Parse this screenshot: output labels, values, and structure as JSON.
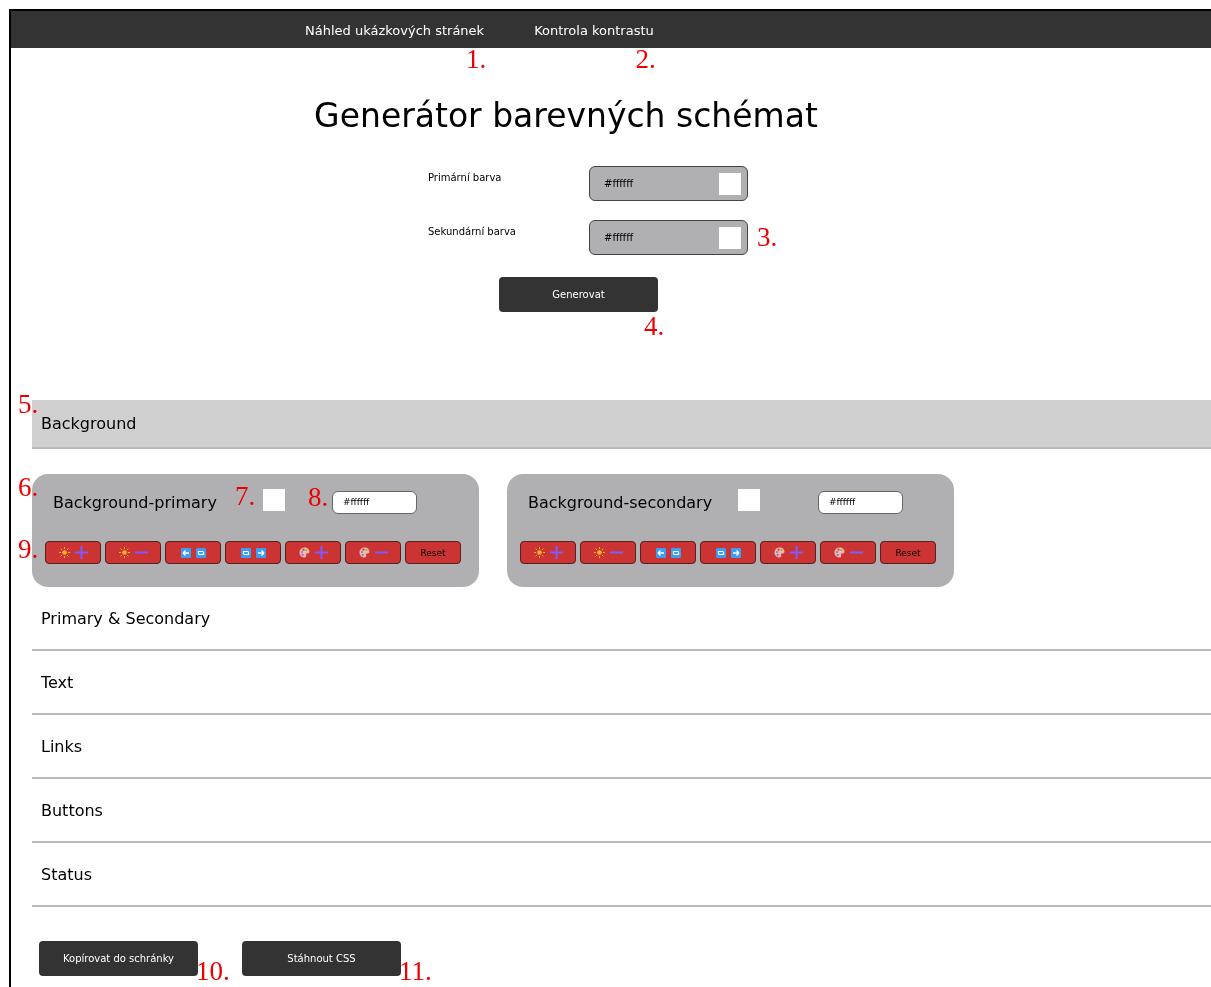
{
  "nav": [
    {
      "label": "Náhled ukázkových stránek",
      "note": "1."
    },
    {
      "label": "Kontrola kontrastu",
      "note": "2."
    }
  ],
  "title": "Generátor barevných schémat",
  "color_inputs": [
    {
      "label": "Primární barva",
      "value": "#ffffff",
      "color": "#ffffff"
    },
    {
      "label": "Sekundární barva",
      "value": "#ffffff",
      "color": "#ffffff",
      "note": "3."
    }
  ],
  "generate_button": {
    "label": "Generovat",
    "note": "4."
  },
  "sections": [
    {
      "title": "Background",
      "expanded": true,
      "note": "5.",
      "cards": [
        {
          "name": "Background-primary",
          "color": "#ffffff",
          "value": "#ffffff",
          "note": "6.",
          "swatch_note": "7.",
          "value_note": "8.",
          "tools_note": "9.",
          "tools": [
            {
              "kind": "lighten"
            },
            {
              "kind": "darken"
            },
            {
              "kind": "shift-left"
            },
            {
              "kind": "shift-right"
            },
            {
              "kind": "saturate"
            },
            {
              "kind": "desaturate"
            },
            {
              "kind": "reset",
              "label": "Reset"
            }
          ]
        },
        {
          "name": "Background-secondary",
          "color": "#ffffff",
          "value": "#ffffff",
          "tools": [
            {
              "kind": "lighten"
            },
            {
              "kind": "darken"
            },
            {
              "kind": "shift-left"
            },
            {
              "kind": "shift-right"
            },
            {
              "kind": "saturate"
            },
            {
              "kind": "desaturate"
            },
            {
              "kind": "reset",
              "label": "Reset"
            }
          ]
        }
      ]
    },
    {
      "title": "Primary & Secondary",
      "expanded": false
    },
    {
      "title": "Text",
      "expanded": false
    },
    {
      "title": "Links",
      "expanded": false
    },
    {
      "title": "Buttons",
      "expanded": false
    },
    {
      "title": "Status",
      "expanded": false
    }
  ],
  "actions": [
    {
      "label": "Kopírovat do schránky",
      "note": "10."
    },
    {
      "label": "Stáhnout CSS",
      "note": "11."
    }
  ]
}
